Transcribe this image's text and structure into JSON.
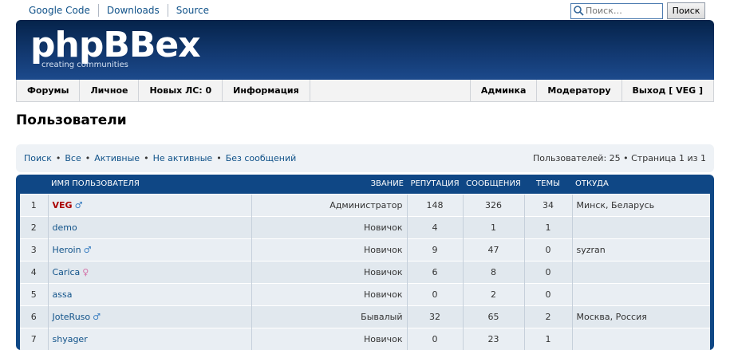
{
  "toplinks": [
    "Google Code",
    "Downloads",
    "Source"
  ],
  "search": {
    "placeholder": "Поиск…",
    "button": "Поиск"
  },
  "header": {
    "logo": "phpBBex",
    "tagline": "creating communities"
  },
  "nav": {
    "left": [
      "Форумы",
      "Личное",
      "Новых ЛС: 0",
      "Информация"
    ],
    "right": [
      "Админка",
      "Модератору",
      "Выход [ VEG ]"
    ]
  },
  "page_title": "Пользователи",
  "filters": [
    "Поиск",
    "Все",
    "Активные",
    "Не активные",
    "Без сообщений"
  ],
  "filter_sep": "•",
  "pageinfo": "Пользователей: 25 • Страница 1 из 1",
  "table": {
    "headers": {
      "name": "Имя пользователя",
      "rank": "Звание",
      "rep": "Репутация",
      "posts": "Сообщения",
      "topics": "Темы",
      "from": "Откуда"
    },
    "rows": [
      {
        "idx": "1",
        "name": "VEG",
        "gender": "♂",
        "rank": "Администратор",
        "rep": "148",
        "posts": "326",
        "topics": "34",
        "from": "Минск, Беларусь"
      },
      {
        "idx": "2",
        "name": "demo",
        "gender": "",
        "rank": "Новичок",
        "rep": "4",
        "posts": "1",
        "topics": "1",
        "from": ""
      },
      {
        "idx": "3",
        "name": "Heroin",
        "gender": "♂",
        "rank": "Новичок",
        "rep": "9",
        "posts": "47",
        "topics": "0",
        "from": "syzran"
      },
      {
        "idx": "4",
        "name": "Carica",
        "gender": "♀",
        "rank": "Новичок",
        "rep": "6",
        "posts": "8",
        "topics": "0",
        "from": ""
      },
      {
        "idx": "5",
        "name": "assa",
        "gender": "",
        "rank": "Новичок",
        "rep": "0",
        "posts": "2",
        "topics": "0",
        "from": ""
      },
      {
        "idx": "6",
        "name": "JoteRuso",
        "gender": "♂",
        "rank": "Бывалый",
        "rep": "32",
        "posts": "65",
        "topics": "2",
        "from": "Москва, Россия"
      },
      {
        "idx": "7",
        "name": "shyager",
        "gender": "",
        "rank": "Новичок",
        "rep": "0",
        "posts": "23",
        "topics": "1",
        "from": ""
      }
    ]
  }
}
